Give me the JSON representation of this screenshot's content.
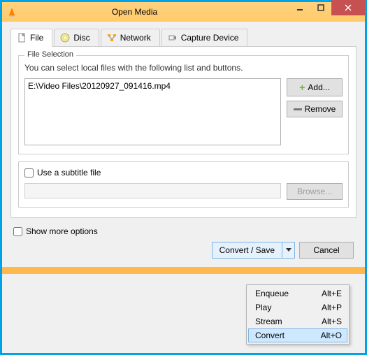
{
  "window": {
    "title": "Open Media"
  },
  "tabs": {
    "file": "File",
    "disc": "Disc",
    "network": "Network",
    "capture": "Capture Device"
  },
  "fileSelection": {
    "legend": "File Selection",
    "hint": "You can select local files with the following list and buttons.",
    "items": [
      "E:\\Video Files\\20120927_091416.mp4"
    ],
    "add": "Add...",
    "remove": "Remove"
  },
  "subtitle": {
    "checkbox": "Use a subtitle file",
    "browse": "Browse..."
  },
  "more": "Show more options",
  "actions": {
    "convert": "Convert / Save",
    "cancel": "Cancel"
  },
  "menu": [
    {
      "label": "Enqueue",
      "shortcut": "Alt+E"
    },
    {
      "label": "Play",
      "shortcut": "Alt+P"
    },
    {
      "label": "Stream",
      "shortcut": "Alt+S"
    },
    {
      "label": "Convert",
      "shortcut": "Alt+O"
    }
  ]
}
